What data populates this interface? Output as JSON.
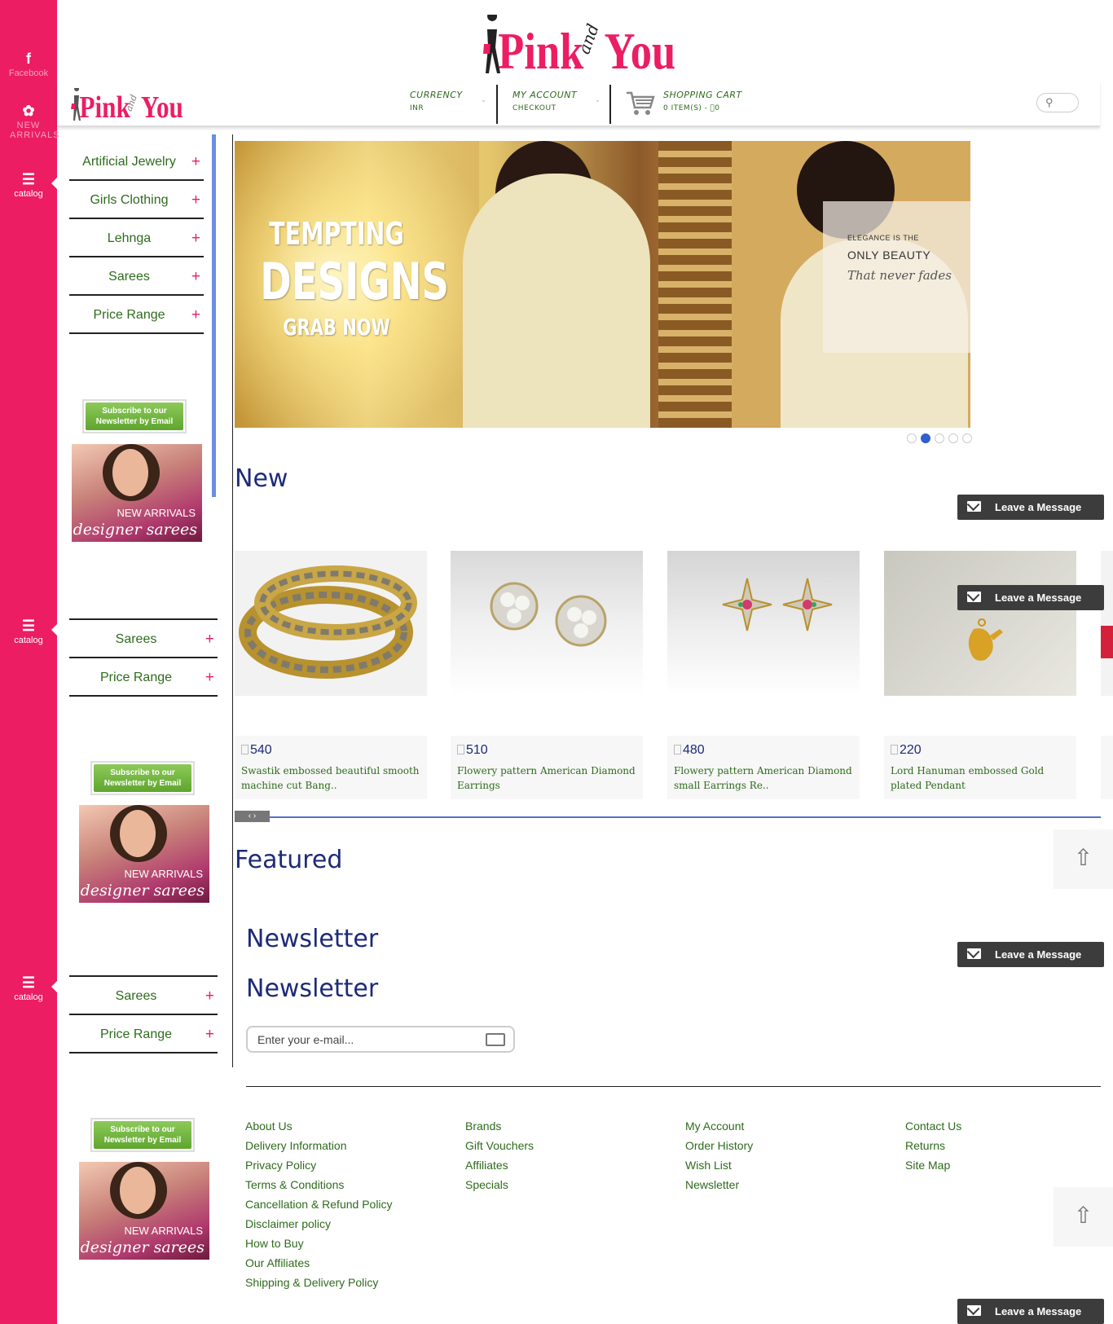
{
  "brand": {
    "logo_text_left": "Pink",
    "logo_text_and": "and",
    "logo_text_right": "You",
    "primary_color": "#ec1d63",
    "accent_green": "#2e6b1c",
    "title_blue": "#1d2a78"
  },
  "rail": {
    "facebook_label": "Facebook",
    "new_arrivals_label": "NEW ARRIVALS",
    "catalog_label": "catalog"
  },
  "header": {
    "currency_title": "CURRENCY",
    "currency_value": "INR",
    "account_title": "MY ACCOUNT",
    "account_sub": "CHECKOUT",
    "cart_title": "SHOPPING CART",
    "cart_sub": "0 ITEM(S) - ⃣0",
    "search_icon": "search-icon"
  },
  "sidebar1": {
    "categories": [
      "Artificial Jewelry",
      "Girls Clothing",
      "Lehnga",
      "Sarees",
      "Price Range"
    ],
    "plus": "+"
  },
  "sidebar2": {
    "categories": [
      "Sarees",
      "Price Range"
    ],
    "plus": "+"
  },
  "sidebar3": {
    "categories": [
      "Sarees",
      "Price Range"
    ],
    "plus": "+"
  },
  "subscribe": {
    "line1": "Subscribe to our",
    "line2": "Newsletter by Email"
  },
  "promo": {
    "line1": "NEW ARRIVALS",
    "line2": "designer sarees"
  },
  "banner": {
    "tempting": "TEMPTING",
    "designs": "DESIGNS",
    "grab": "GRAB NOW",
    "overlay_line1": "ELEGANCE IS THE",
    "overlay_line2": "ONLY BEAUTY",
    "overlay_line3": "That never fades",
    "active_slide": 2,
    "slide_count": 5
  },
  "sections": {
    "new_title": "New",
    "featured_title": "Featured",
    "newsletter_title_1": "Newsletter",
    "newsletter_title_2": "Newsletter"
  },
  "leave_message": "Leave a Message",
  "products": [
    {
      "price": "540",
      "name": "Swastik embossed beautiful smooth machine cut Bang.."
    },
    {
      "price": "510",
      "name": "Flowery pattern American Diamond Earrings"
    },
    {
      "price": "480",
      "name": "Flowery pattern American Diamond small Earrings Re.."
    },
    {
      "price": "220",
      "name": "Lord Hanuman embossed Gold plated Pendant"
    }
  ],
  "carousel_nav": "‹ ›",
  "newsletter": {
    "placeholder": "Enter your e-mail..."
  },
  "footer": {
    "col1": [
      "About Us",
      "Delivery Information",
      "Privacy Policy",
      "Terms & Conditions",
      "Cancellation & Refund Policy",
      "Disclaimer policy",
      "How to Buy",
      "Our Affiliates",
      "Shipping & Delivery Policy"
    ],
    "col2": [
      "Brands",
      "Gift Vouchers",
      "Affiliates",
      "Specials"
    ],
    "col3": [
      "My Account",
      "Order History",
      "Wish List",
      "Newsletter"
    ],
    "col4": [
      "Contact Us",
      "Returns",
      "Site Map"
    ]
  }
}
